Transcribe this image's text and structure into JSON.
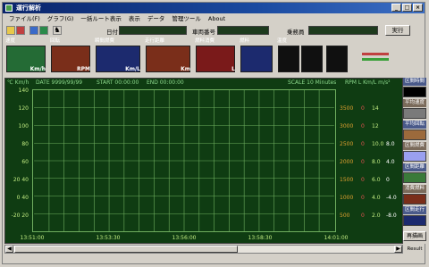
{
  "window": {
    "title": "運行解析",
    "min": "_",
    "max": "□",
    "close": "×"
  },
  "menu": [
    "ファイル(F)",
    "グラフ(G)",
    "一括ルート表示",
    "表示",
    "データ",
    "管理ツール",
    "About"
  ],
  "toolbar": {
    "date_label": "日付",
    "vehicle_label": "車両番号",
    "driver_label": "乗務員",
    "exec": "実行"
  },
  "gauges": [
    {
      "label": "速度",
      "unit": "Km/h",
      "color": "#246b35"
    },
    {
      "label": "回転",
      "unit": "RPM",
      "color": "#7a2e1a"
    },
    {
      "label": "瞬間燃費",
      "unit": "",
      "color": "#1c2a6e"
    },
    {
      "label": "走行距離",
      "unit": "Km/L",
      "color": "#7a2e1a"
    },
    {
      "label": "燃料消費",
      "unit": "Km",
      "color": "#7a1a1a"
    },
    {
      "label": "燃料",
      "unit": "L",
      "color": "#1c2a6e"
    },
    {
      "label": "温度",
      "unit": "",
      "color": "#101010"
    }
  ],
  "chart_header": {
    "units_left": "℃ Km/h",
    "date": "DATE  9999/99/99",
    "start": "START  00:00:00",
    "end": "END  00:00:00",
    "scale": "SCALE  10 Minutes",
    "units_right": "RPM  L  Km/L  m/s²"
  },
  "chart_data": {
    "type": "line",
    "xlabels": [
      "13:51:00",
      "13:53:30",
      "13:56:00",
      "13:58:30",
      "14:01:00"
    ],
    "ylabels_left": [
      "140",
      "120",
      "100",
      "80",
      "60",
      "20  40",
      "0  40",
      "-20  20"
    ],
    "rpm": [
      "3500",
      "3000",
      "2500",
      "2000",
      "1500",
      "1000",
      "500"
    ],
    "liters": [
      "0",
      "0",
      "0",
      "0",
      "0",
      "0",
      "0"
    ],
    "kml": [
      "14",
      "12",
      "10.0",
      "8.0",
      "6.0",
      "4.0",
      "2.0"
    ],
    "extra": [
      "",
      "",
      "8.0",
      "4.0",
      "0",
      "-4.0",
      "-8.0"
    ],
    "series": []
  },
  "side_panel": [
    {
      "label": "区間時間",
      "color": "#000"
    },
    {
      "label": "平均速度",
      "color": "#7a7a7a"
    },
    {
      "label": "平均回転",
      "color": "#9c6a3c"
    },
    {
      "label": "区間燃費",
      "color": "#9aa0f0"
    },
    {
      "label": "区間距離",
      "color": "#3a7a3a"
    },
    {
      "label": "消費燃料",
      "color": "#7a2e1a"
    },
    {
      "label": "区間走行",
      "color": "#1c2a6e"
    }
  ],
  "side_button": "再描画",
  "side_small": "Result",
  "colors": {
    "chart_bg": "#0f3c12",
    "grid": "#6fae5f",
    "title": "#0a246a"
  }
}
